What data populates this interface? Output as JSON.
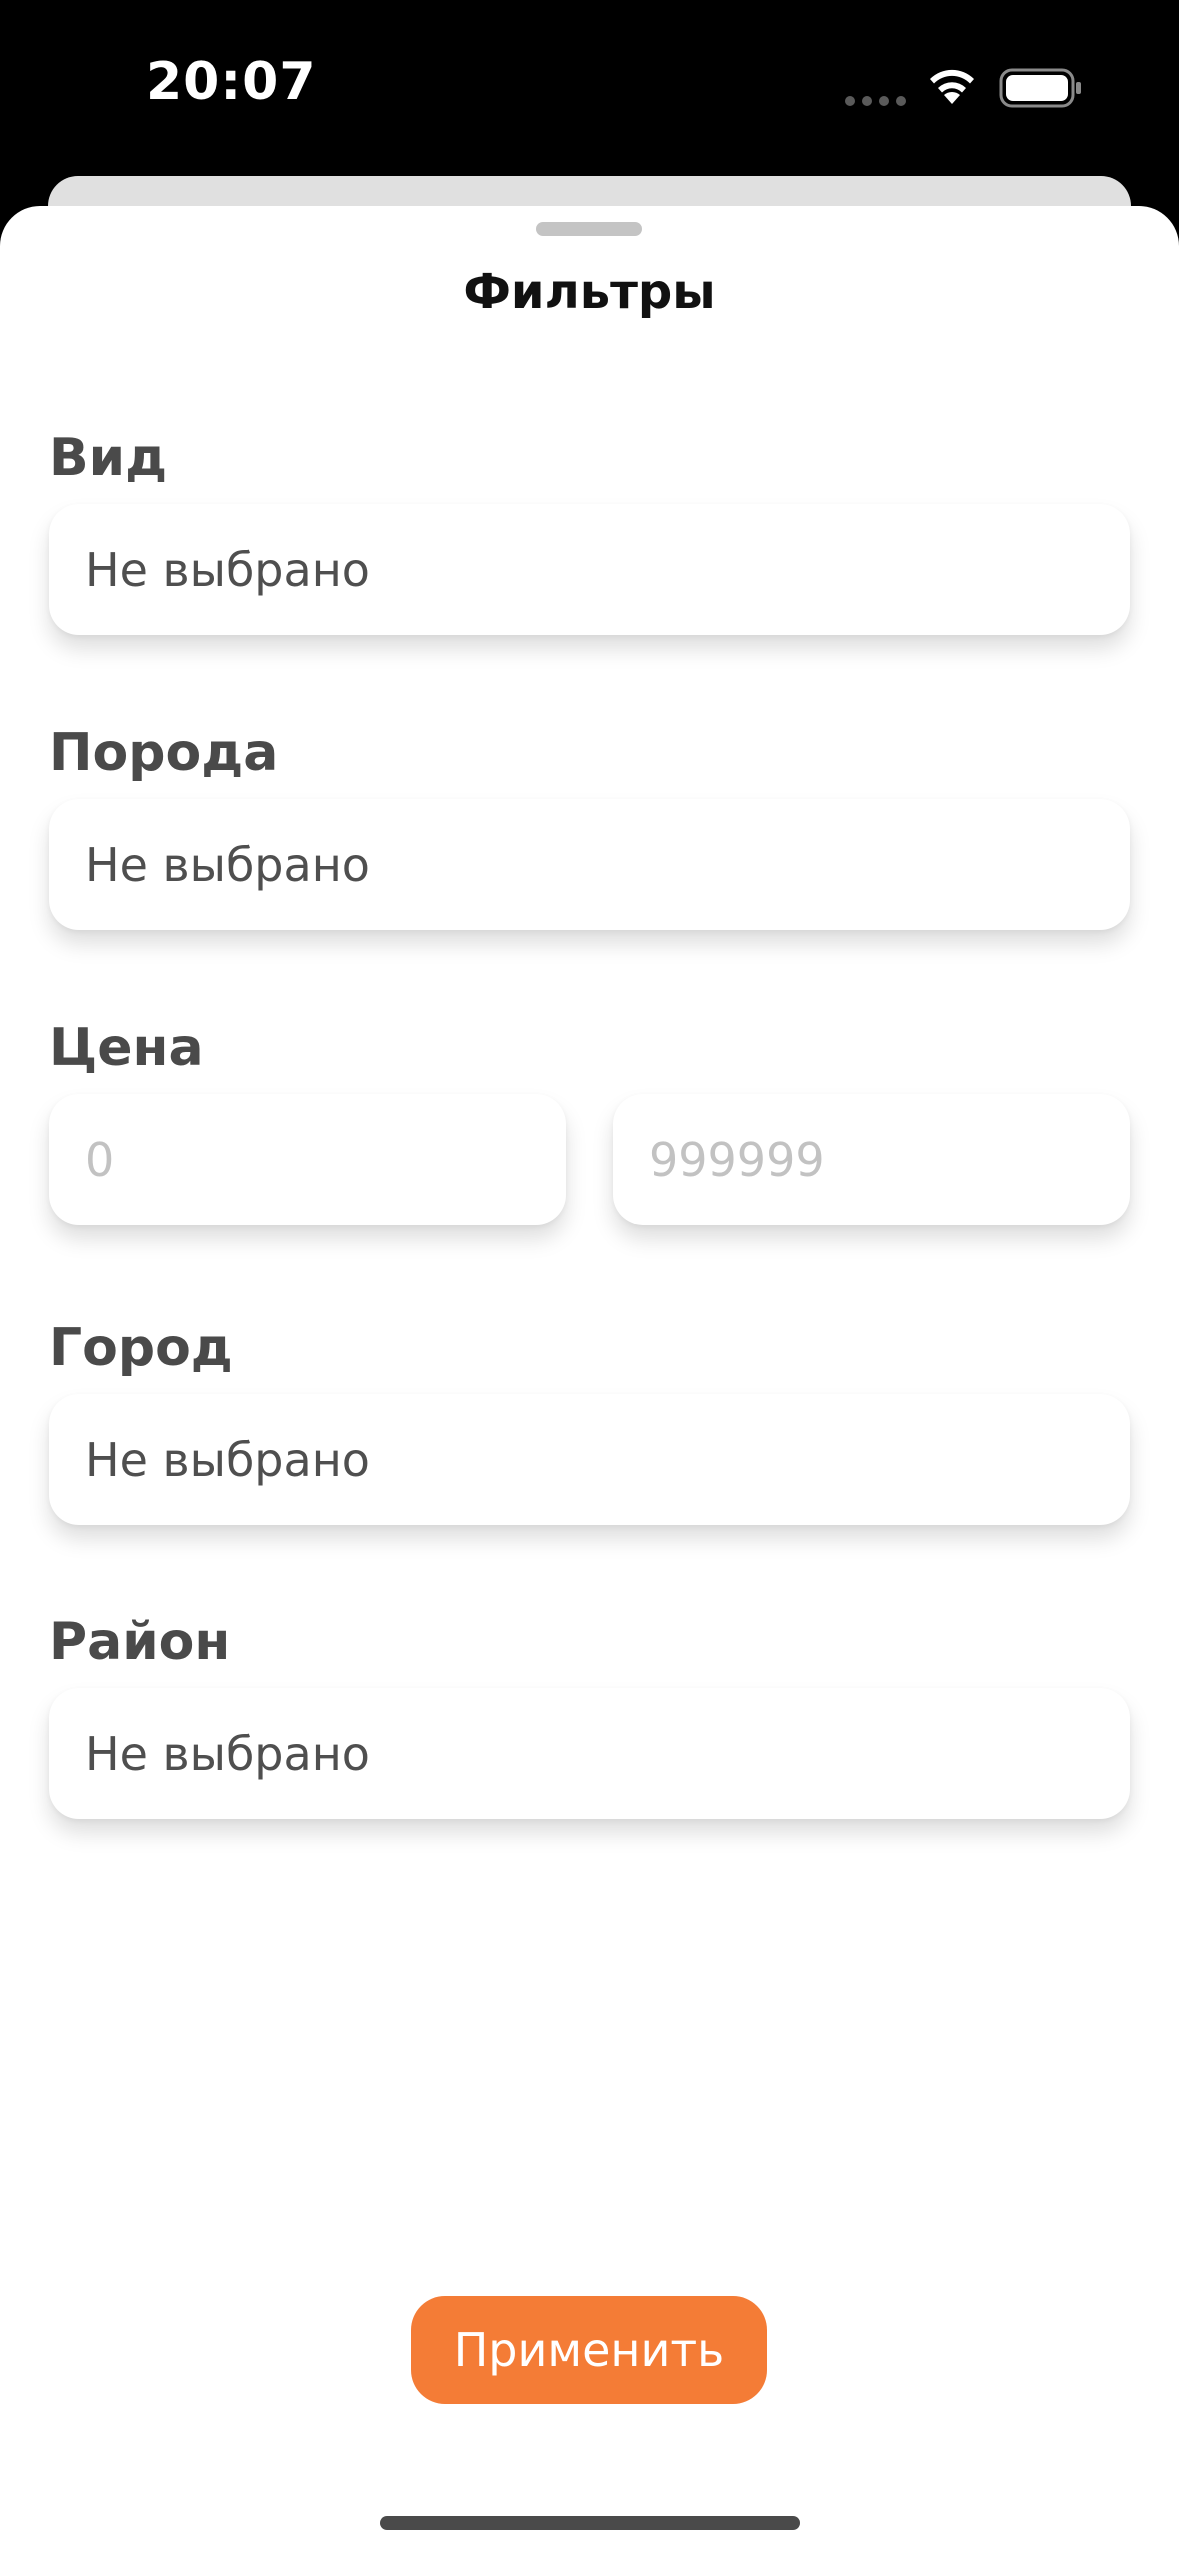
{
  "status_bar": {
    "time": "20:07"
  },
  "sheet": {
    "title": "Фильтры"
  },
  "filters": {
    "kind": {
      "label": "Вид",
      "value": "Не выбрано"
    },
    "breed": {
      "label": "Порода",
      "value": "Не выбрано"
    },
    "price": {
      "label": "Цена",
      "min_placeholder": "0",
      "max_placeholder": "999999"
    },
    "city": {
      "label": "Город",
      "value": "Не выбрано"
    },
    "district": {
      "label": "Район",
      "value": "Не выбрано"
    }
  },
  "apply_button": {
    "label": "Применить"
  },
  "colors": {
    "accent": "#f47c36",
    "label_text": "#4a4a4a",
    "value_text": "#4f4f4f",
    "placeholder_text": "#c2c2c2"
  }
}
